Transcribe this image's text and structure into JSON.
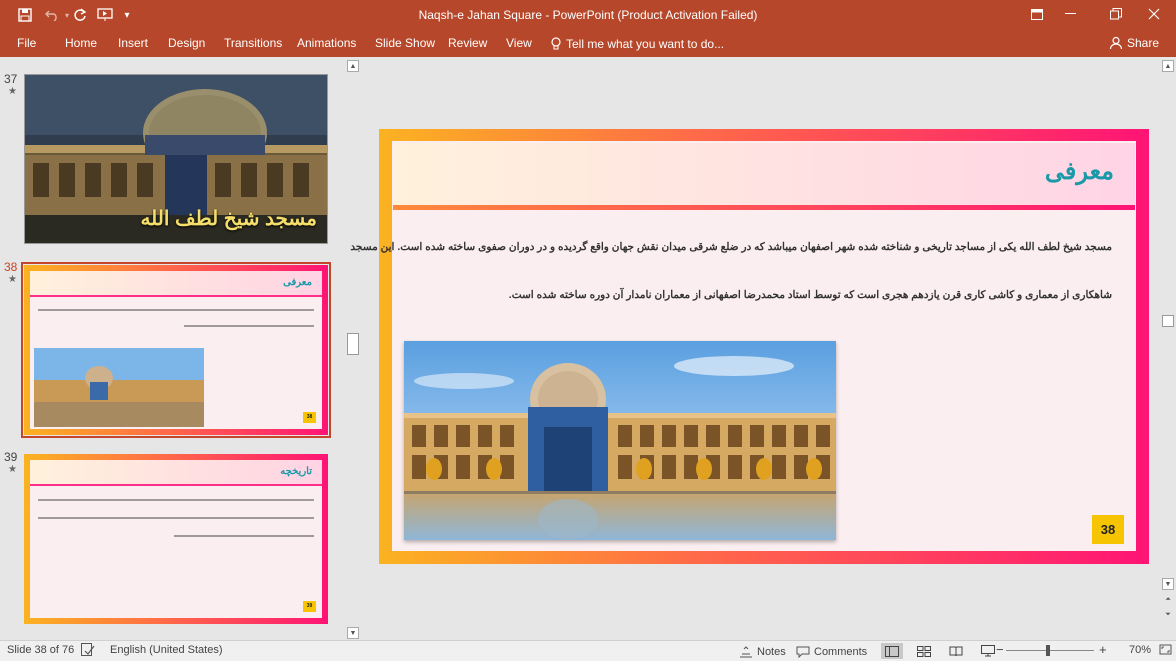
{
  "titlebar": {
    "document_title": "Naqsh-e Jahan Square - PowerPoint (Product Activation Failed)",
    "accent": "#b7472a"
  },
  "ribbon": {
    "tabs": [
      {
        "label": "File",
        "name": "tab-file"
      },
      {
        "label": "Home",
        "name": "tab-home"
      },
      {
        "label": "Insert",
        "name": "tab-insert"
      },
      {
        "label": "Design",
        "name": "tab-design"
      },
      {
        "label": "Transitions",
        "name": "tab-transitions"
      },
      {
        "label": "Animations",
        "name": "tab-animations"
      },
      {
        "label": "Slide Show",
        "name": "tab-slide-show"
      },
      {
        "label": "Review",
        "name": "tab-review"
      },
      {
        "label": "View",
        "name": "tab-view"
      }
    ],
    "tell_me": "Tell me what you want to do...",
    "share": "Share"
  },
  "thumbnails": [
    {
      "number": "37",
      "star": "★",
      "title": "مسجد شیخ لطف الله"
    },
    {
      "number": "38",
      "star": "★",
      "title": "معرفی",
      "badge": "38"
    },
    {
      "number": "39",
      "star": "★",
      "title": "تاریخچه",
      "badge": "39"
    }
  ],
  "slide": {
    "title": "معرفی",
    "paragraph_line1": "مسجد شیخ لطف الله یکی از مساجد تاریخی و شناخته شده شهر اصفهان میباشد که در ضلع شرقی میدان نقش جهان واقع گردیده و در دوران صفوی ساخته شده است. این مسجد",
    "paragraph_line2": "شاهکاری از معماری و کاشی کاری قرن یازدهم هجری است که توسط استاد محمدرضا اصفهانی از معماران نامدار آن دوره ساخته شده است.",
    "badge": "38"
  },
  "statusbar": {
    "slide_info": "Slide 38 of 76",
    "language": "English (United States)",
    "notes": "Notes",
    "comments": "Comments",
    "zoom": "70%",
    "zoom_out": "−",
    "zoom_in": "+"
  }
}
